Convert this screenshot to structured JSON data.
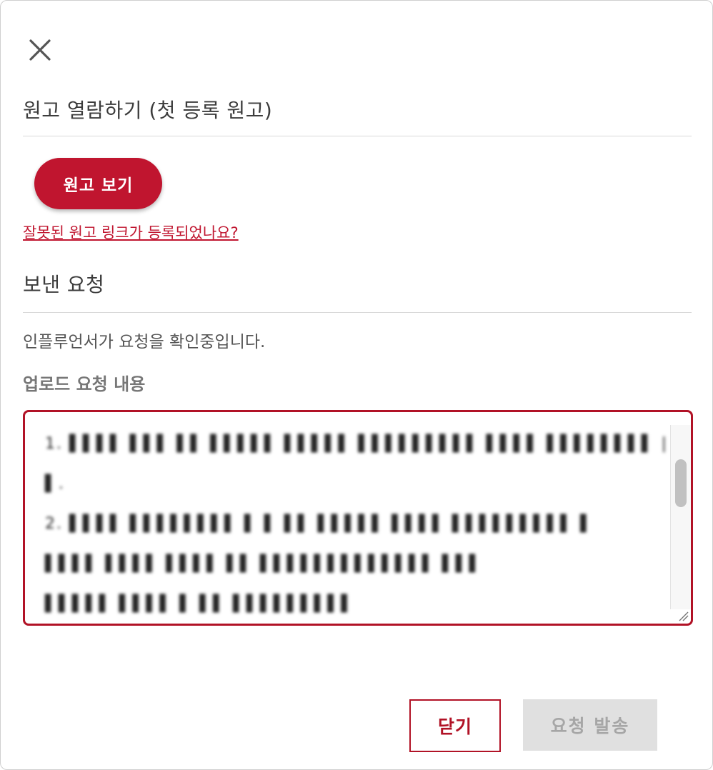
{
  "dialog": {
    "close_icon": "close-icon",
    "preview_section": {
      "title": "원고 열람하기 (첫 등록 원고)",
      "view_button_label": "원고 보기",
      "wrong_link_text": "잘못된 원고 링크가 등록되었나요?"
    },
    "request_section": {
      "title": "보낸 요청",
      "status_text": "인플루언서가 요청을 확인중입니다.",
      "field_label": "업로드 요청 내용",
      "textarea_lines": [
        "1. ▌▌▌▌ ▌▌▌ ▌▌ ▌▌▌▌▌ ▌▌▌▌▌ ▌▌▌▌▌▌▌▌▌ ▌▌▌▌ ▌▌▌▌▌▌▌▌ |",
        "▌.",
        "2. ▌▌▌▌ ▌▌▌▌▌▌▌▌ ▌ ▌ ▌▌ ▌▌▌▌▌ ▌▌▌▌ ▌▌▌▌▌▌▌▌▌ ▌",
        "▌▌▌▌ ▌▌▌▌ ▌▌▌▌ ▌▌ ▌▌▌▌▌▌▌▌▌▌▌▌▌ ▌▌▌",
        "▌▌▌▌▌ ▌▌▌▌ ▌ ▌▌ ▌▌▌▌▌▌▌▌▌"
      ],
      "scroll_position": 0.25,
      "scroll_visible_fraction": 0.26
    },
    "actions": {
      "close_label": "닫기",
      "send_label": "요청 발송"
    },
    "colors": {
      "accent": "#c0152f",
      "accent_border": "#b11226",
      "disabled_bg": "#e0e0e0",
      "disabled_text": "#a6a6a6"
    }
  }
}
